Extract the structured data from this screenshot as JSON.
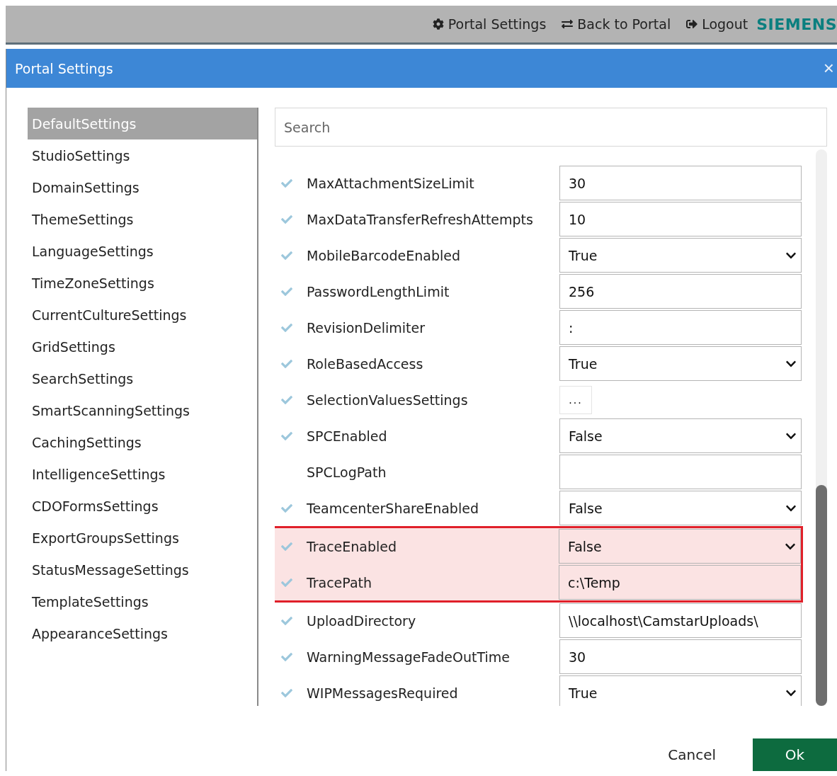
{
  "top_bar": {
    "links": [
      {
        "kind": "gear",
        "label": "Portal Settings"
      },
      {
        "kind": "back",
        "label": "Back to Portal"
      },
      {
        "kind": "logout",
        "label": "Logout"
      }
    ],
    "brand": "SIEMENS"
  },
  "dialog": {
    "title": "Portal Settings",
    "close": "×",
    "sidebar": {
      "items": [
        {
          "label": "DefaultSettings",
          "selected": true
        },
        {
          "label": "StudioSettings",
          "selected": false
        },
        {
          "label": "DomainSettings",
          "selected": false
        },
        {
          "label": "ThemeSettings",
          "selected": false
        },
        {
          "label": "LanguageSettings",
          "selected": false
        },
        {
          "label": "TimeZoneSettings",
          "selected": false
        },
        {
          "label": "CurrentCultureSettings",
          "selected": false
        },
        {
          "label": "GridSettings",
          "selected": false
        },
        {
          "label": "SearchSettings",
          "selected": false
        },
        {
          "label": "SmartScanningSettings",
          "selected": false
        },
        {
          "label": "CachingSettings",
          "selected": false
        },
        {
          "label": "IntelligenceSettings",
          "selected": false
        },
        {
          "label": "CDOFormsSettings",
          "selected": false
        },
        {
          "label": "ExportGroupsSettings",
          "selected": false
        },
        {
          "label": "StatusMessageSettings",
          "selected": false
        },
        {
          "label": "TemplateSettings",
          "selected": false
        },
        {
          "label": "AppearanceSettings",
          "selected": false
        }
      ]
    },
    "search": {
      "placeholder": "Search"
    },
    "settings": [
      {
        "name": "MaxAttachmentSizeLimit",
        "kind": "text",
        "value": "30",
        "checked": true,
        "highlighted": false
      },
      {
        "name": "MaxDataTransferRefreshAttempts",
        "kind": "text",
        "value": "10",
        "checked": true,
        "highlighted": false
      },
      {
        "name": "MobileBarcodeEnabled",
        "kind": "select",
        "value": "True",
        "checked": true,
        "highlighted": false
      },
      {
        "name": "PasswordLengthLimit",
        "kind": "text",
        "value": "256",
        "checked": true,
        "highlighted": false
      },
      {
        "name": "RevisionDelimiter",
        "kind": "text",
        "value": ":",
        "checked": true,
        "highlighted": false
      },
      {
        "name": "RoleBasedAccess",
        "kind": "select",
        "value": "True",
        "checked": true,
        "highlighted": false
      },
      {
        "name": "SelectionValuesSettings",
        "kind": "ellipsis",
        "value": "...",
        "checked": true,
        "highlighted": false
      },
      {
        "name": "SPCEnabled",
        "kind": "select",
        "value": "False",
        "checked": true,
        "highlighted": false
      },
      {
        "name": "SPCLogPath",
        "kind": "text",
        "checked": false,
        "highlighted": false
      },
      {
        "name": "TeamcenterShareEnabled",
        "kind": "select",
        "value": "False",
        "checked": true,
        "highlighted": false
      },
      {
        "name": "TraceEnabled",
        "kind": "select",
        "value": "False",
        "checked": true,
        "highlighted": true
      },
      {
        "name": "TracePath",
        "kind": "text",
        "value": "c:\\Temp",
        "checked": true,
        "highlighted": true
      },
      {
        "name": "UploadDirectory",
        "kind": "text",
        "value": "\\\\localhost\\CamstarUploads\\",
        "checked": true,
        "highlighted": false
      },
      {
        "name": "WarningMessageFadeOutTime",
        "kind": "text",
        "value": "30",
        "checked": true,
        "highlighted": false
      },
      {
        "name": "WIPMessagesRequired",
        "kind": "select",
        "value": "True",
        "checked": true,
        "highlighted": false
      }
    ],
    "buttons": [
      {
        "kind": "cancel",
        "label": "Cancel"
      },
      {
        "kind": "ok",
        "label": "Ok"
      }
    ]
  }
}
